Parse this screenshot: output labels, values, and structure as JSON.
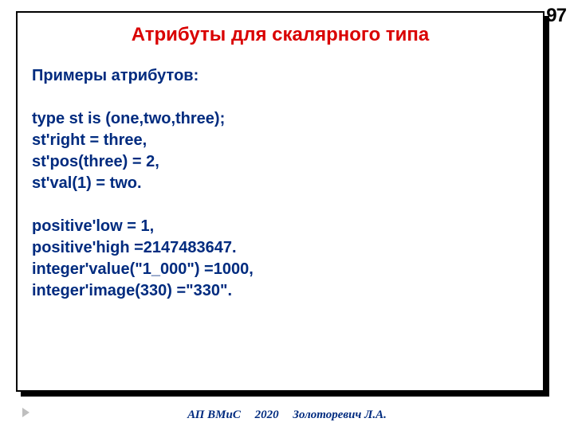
{
  "page_number": "97",
  "title": "Атрибуты для скалярного типа",
  "body": {
    "heading": "Примеры атрибутов:",
    "lines": [
      "type st is (one,two,three);",
      "st'right = three,",
      "st'pos(three) = 2,",
      "st'val(1) = two.",
      "",
      "positive'low =  1,",
      "positive'high =2147483647.",
      "integer'value(\"1_000\") =1000,",
      "integer'image(330) =\"330\"."
    ]
  },
  "footer": {
    "course": "АП ВМиС",
    "year": "2020",
    "author": "Золоторевич Л.А."
  }
}
